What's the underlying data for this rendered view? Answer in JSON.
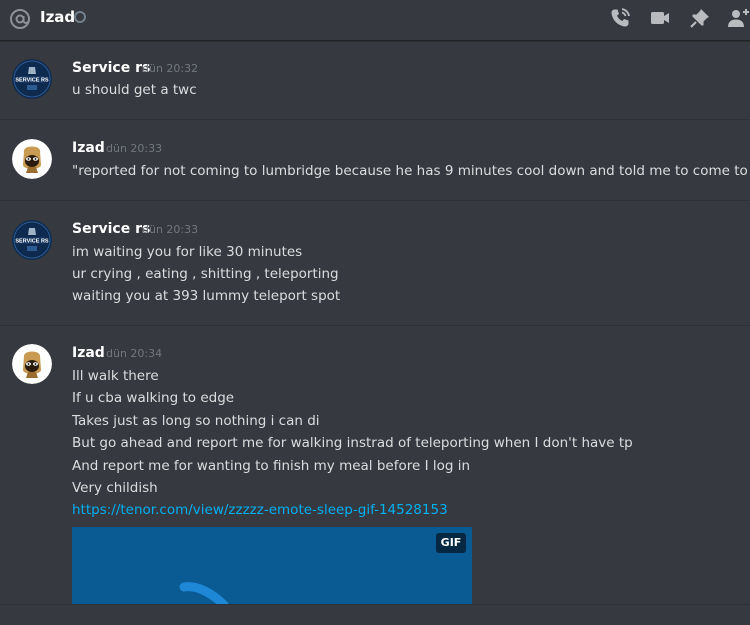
{
  "header": {
    "channel_name": "Izad",
    "icons": [
      "at-icon",
      "status-offline-icon",
      "phone-call-icon",
      "video-call-icon",
      "pin-icon",
      "add-friend-icon"
    ]
  },
  "messages": [
    {
      "author": "Service rs",
      "timestamp": "dün 20:32",
      "avatar": "service-rs-avatar",
      "lines": [
        "u should get a twc"
      ]
    },
    {
      "author": "Izad",
      "timestamp": "dün 20:33",
      "avatar": "bape-avatar",
      "lines": [
        "\"reported for not coming to lumbridge because he has 9 minutes cool down and told me to come to edgeville"
      ]
    },
    {
      "author": "Service rs",
      "timestamp": "dün 20:33",
      "avatar": "service-rs-avatar",
      "lines": [
        "im waiting you for like 30 minutes",
        "ur crying , eating , shitting , teleporting",
        "waiting you at 393 lummy teleport spot"
      ]
    },
    {
      "author": "Izad",
      "timestamp": "dün 20:34",
      "avatar": "bape-avatar",
      "lines": [
        "Ill walk there",
        "If u cba walking to edge",
        "Takes just as long so nothing i can di",
        "But go ahead and report me for walking instrad of teleporting when I don't have tp",
        "And report me for wanting to finish my meal before I  log in",
        "Very childish"
      ],
      "link": "https://tenor.com/view/zzzzz-emote-sleep-gif-14528153",
      "gif_badge": "GIF"
    }
  ],
  "colors": {
    "background": "#36393f",
    "author": "#ffffff",
    "timestamp": "#72767d",
    "text": "#dcddde",
    "link": "#00b0f4"
  }
}
